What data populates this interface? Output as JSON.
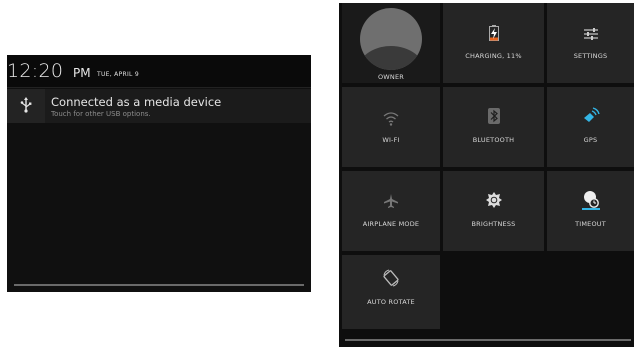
{
  "notification_shade": {
    "time": "12:20",
    "ampm": "PM",
    "date": "TUE, APRIL 9",
    "notification": {
      "title": "Connected as a media device",
      "subtitle": "Touch for other USB options.",
      "icon": "usb-icon"
    }
  },
  "quick_settings": {
    "tiles": [
      {
        "label": "OWNER",
        "icon": "avatar-icon"
      },
      {
        "label": "CHARGING, 11%",
        "icon": "battery-charging-icon"
      },
      {
        "label": "SETTINGS",
        "icon": "settings-sliders-icon"
      },
      {
        "label": "WI-FI",
        "icon": "wifi-icon"
      },
      {
        "label": "BLUETOOTH",
        "icon": "bluetooth-icon"
      },
      {
        "label": "GPS",
        "icon": "gps-icon"
      },
      {
        "label": "AIRPLANE MODE",
        "icon": "airplane-icon"
      },
      {
        "label": "BRIGHTNESS",
        "icon": "brightness-icon"
      },
      {
        "label": "TIMEOUT",
        "icon": "timeout-icon"
      },
      {
        "label": "AUTO ROTATE",
        "icon": "auto-rotate-icon"
      }
    ]
  },
  "colors": {
    "accent_blue": "#33b5e5",
    "battery_orange": "#e8631c",
    "tile_bg": "#252525",
    "panel_bg": "#0e0e0e"
  }
}
